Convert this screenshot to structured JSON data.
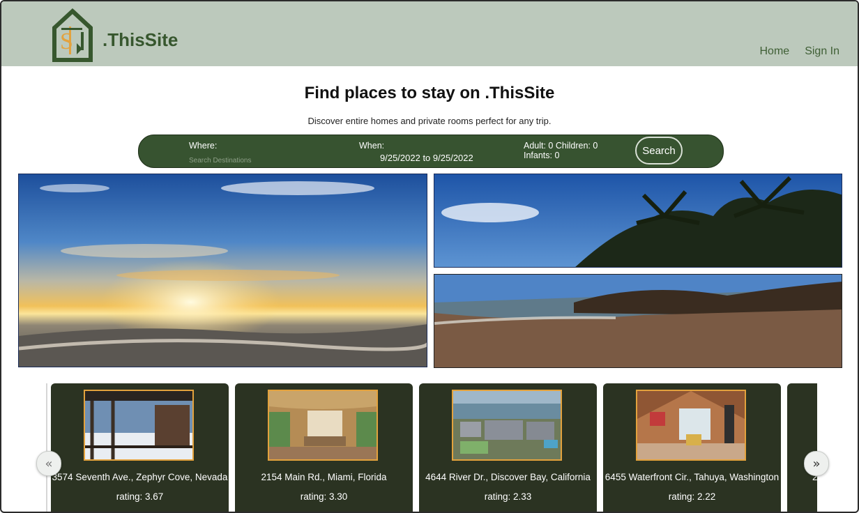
{
  "header": {
    "brand": ".ThisSite",
    "nav": [
      {
        "label": "Home"
      },
      {
        "label": "Sign In"
      }
    ]
  },
  "hero": {
    "title": "Find places to stay on .ThisSite",
    "subtitle": "Discover entire homes and private rooms perfect for any trip."
  },
  "search": {
    "where_label": "Where:",
    "where_placeholder": "Search Destinations",
    "when_label": "When:",
    "dates": "9/25/2022 to 9/25/2022",
    "guests_line1": "Adult: 0 Children: 0",
    "guests_line2": "Infants: 0",
    "button_label": "Search"
  },
  "listings": [
    {
      "address": "3574 Seventh Ave., Zephyr Cove, Nevada",
      "rating": "rating: 3.67"
    },
    {
      "address": "2154 Main Rd., Miami, Florida",
      "rating": "rating: 3.30"
    },
    {
      "address": "4644 River Dr., Discover Bay, California",
      "rating": "rating: 2.33"
    },
    {
      "address": "6455 Waterfront Cir., Tahuya, Washington",
      "rating": "rating: 2.22"
    },
    {
      "address": "2",
      "rating": ""
    }
  ],
  "carousel": {
    "prev_icon": "double-chevron-left-icon",
    "next_icon": "double-chevron-right-icon"
  },
  "colors": {
    "header_bg": "#bcc9bc",
    "brand": "#37572e",
    "searchbar_bg": "#375330",
    "card_bg": "#2b3322",
    "photo_border": "#e3a23d"
  }
}
